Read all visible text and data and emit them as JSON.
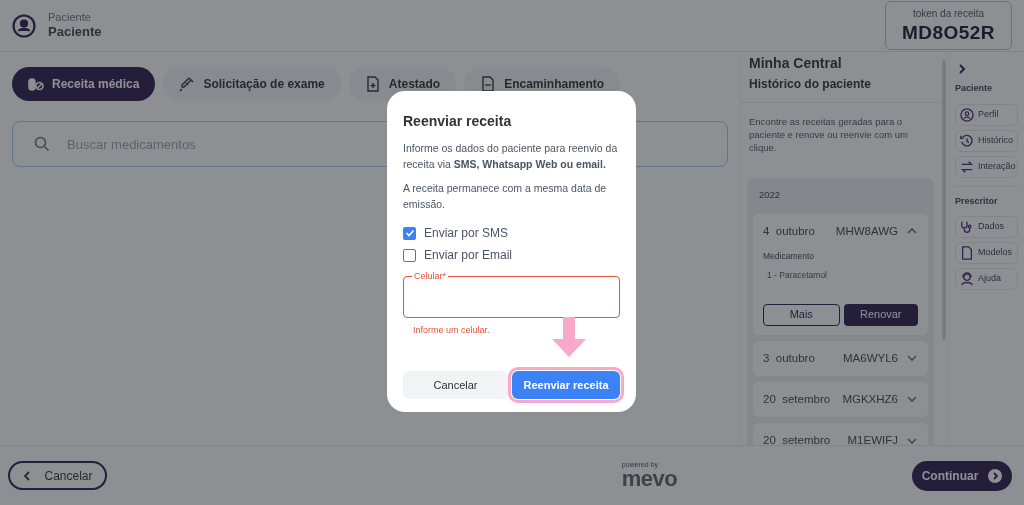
{
  "header": {
    "label": "Paciente",
    "name": "Paciente"
  },
  "token": {
    "label": "token da receita",
    "value": "MD8O52R"
  },
  "tabs": [
    {
      "label": "Receita médica",
      "kind": "pills",
      "selected": true
    },
    {
      "label": "Solicitação de exame",
      "kind": "syringe",
      "selected": false
    },
    {
      "label": "Atestado",
      "kind": "doc-plus",
      "selected": false
    },
    {
      "label": "Encaminhamento",
      "kind": "doc",
      "selected": false
    }
  ],
  "search": {
    "placeholder": "Buscar medicamentos"
  },
  "history": {
    "title": "Minha Central",
    "subtitle": "Histórico do paciente",
    "description": "Encontre as receitas geradas para o paciente e renove ou reenvie com um clique.",
    "year": "2022",
    "entries": [
      {
        "day": "4",
        "month": "outubro",
        "token": "MHW8AWG",
        "expanded": true,
        "heading": "Medicamento",
        "items": [
          "1 - Paracetamol"
        ],
        "more": "Mais",
        "renew": "Renovar"
      },
      {
        "day": "3",
        "month": "outubro",
        "token": "MA6WYL6",
        "expanded": false
      },
      {
        "day": "20",
        "month": "setembro",
        "token": "MGKXHZ6",
        "expanded": false
      },
      {
        "day": "20",
        "month": "setembro",
        "token": "M1EWIFJ",
        "expanded": false
      }
    ]
  },
  "nav": {
    "sections": [
      {
        "heading": "Paciente",
        "items": [
          {
            "label": "Perfil",
            "kind": "user"
          },
          {
            "label": "Histórico",
            "kind": "history"
          },
          {
            "label": "Interação",
            "kind": "swap"
          }
        ]
      },
      {
        "heading": "Prescritor",
        "items": [
          {
            "label": "Dados",
            "kind": "stetho"
          },
          {
            "label": "Modelos",
            "kind": "doc"
          },
          {
            "label": "Ajuda",
            "kind": "help"
          }
        ]
      }
    ]
  },
  "modal": {
    "title": "Reenviar receita",
    "text": "Informe os dados do paciente para reenvio da receita via **SMS, Whatsapp Web ou email.**",
    "note": "A receita permanece com a mesma data de emissão.",
    "options": [
      {
        "label": "Enviar por SMS",
        "checked": true
      },
      {
        "label": "Enviar por Email",
        "checked": false
      }
    ],
    "field": {
      "label": "Celular*",
      "error": "Informe um celular."
    },
    "cancel": "Cancelar",
    "submit": "Reenviar receita",
    "highlighted": true
  },
  "footer": {
    "cancel": "Cancelar",
    "logo_caption": "powered by",
    "logo": "mevo",
    "continue": "Continuar"
  }
}
